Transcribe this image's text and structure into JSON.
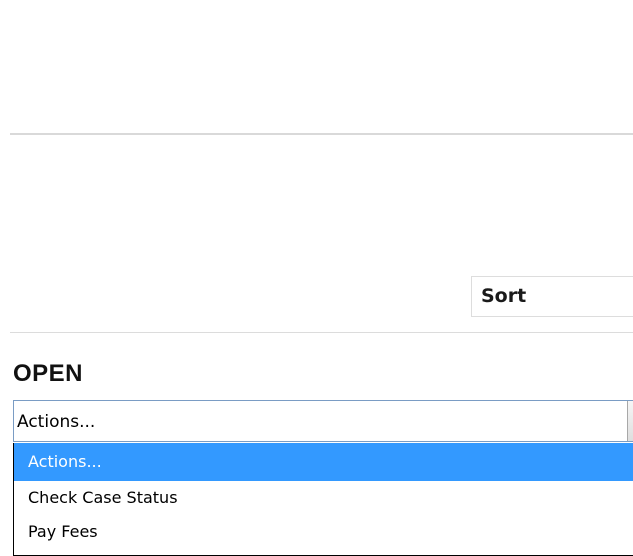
{
  "sort_header": {
    "label": "Sort"
  },
  "section": {
    "title": "OPEN"
  },
  "actions_select": {
    "value": "Actions...",
    "options": [
      {
        "label": "Actions...",
        "selected": true
      },
      {
        "label": "Check Case Status",
        "selected": false
      },
      {
        "label": "Pay Fees",
        "selected": false
      }
    ]
  },
  "colors": {
    "selection_highlight": "#3399ff",
    "select_border": "#7a9cc4",
    "divider": "#d9d9d9"
  },
  "icons": {
    "select_arrow": "chevron-down-icon"
  }
}
